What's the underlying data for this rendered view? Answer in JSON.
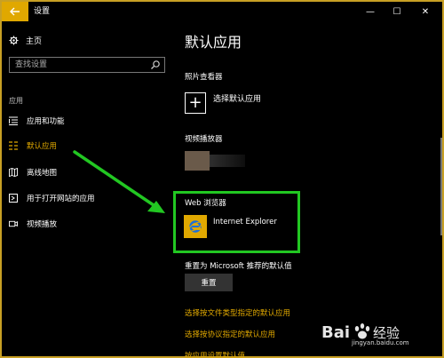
{
  "window": {
    "title": "设置",
    "minimize": "—",
    "maximize": "☐",
    "close": "✕"
  },
  "sidebar": {
    "home": "主页",
    "search_placeholder": "查找设置",
    "section": "应用",
    "items": [
      {
        "label": "应用和功能",
        "icon": "list-icon"
      },
      {
        "label": "默认应用",
        "icon": "default-apps-icon"
      },
      {
        "label": "离线地图",
        "icon": "map-icon"
      },
      {
        "label": "用于打开网站的应用",
        "icon": "open-website-icon"
      },
      {
        "label": "视频播放",
        "icon": "video-icon"
      }
    ]
  },
  "main": {
    "title": "默认应用",
    "photo_viewer": {
      "label": "照片查看器",
      "choose": "选择默认应用"
    },
    "video_player": {
      "label": "视频播放器"
    },
    "web_browser": {
      "label": "Web 浏览器",
      "app": "Internet Explorer"
    },
    "reset": {
      "label": "重置为 Microsoft 推荐的默认值",
      "button": "重置"
    },
    "links": [
      "选择按文件类型指定的默认应用",
      "选择按协议指定的默认应用",
      "按应用设置默认值"
    ]
  },
  "colors": {
    "accent": "#e0a800",
    "highlight": "#22c722",
    "background": "#000000"
  },
  "watermark": {
    "url": "jingyan.baidu.com",
    "brand": "Bai",
    "brand_suffix": "经验"
  }
}
